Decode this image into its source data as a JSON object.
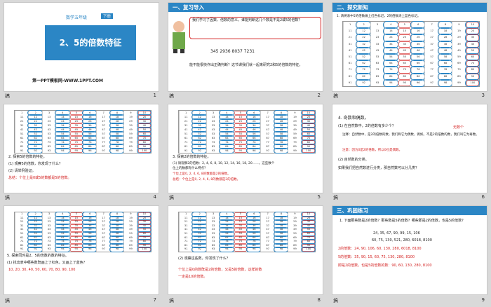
{
  "s1": {
    "tag": "数学五年级",
    "tag2": "下册",
    "title": "2、5的倍数特征",
    "footer": "第一PPT模板网-WWW.1PPT.COM",
    "num": "1",
    "icon": "搞"
  },
  "s2": {
    "header": "一、复习导入",
    "text": "我们学习了因数、倍数的意义，谁能判断这几个数是不是2或5的倍数？",
    "nums": "345    2936   8037   7231",
    "q": "能不能很快作出正确判断？这节课我们就一起来研究2和5的倍数的特征。",
    "num": "2",
    "icon": "搞"
  },
  "s3": {
    "header": "二、探究新知",
    "step": "1. 请将表中5的倍数做上红色标记，2的倍数涂上蓝色标记。",
    "num": "3",
    "icon": "搞"
  },
  "s4": {
    "step": "2. 探索5的倍数的特征。",
    "q1": "(1) 观察5的倍数，你发现了什么？",
    "q2": "(2) 请举例验证。",
    "ans": "总结：个位上是0或5的数都是5的倍数。",
    "num": "4",
    "icon": "搞"
  },
  "s5": {
    "step": "3. 探索2的倍数的特征。",
    "q1": "(1) 请观察2的倍数：2, 4, 6, 8, 10, 12, 14, 16, 18, 20……，这些数个",
    "q1b": "位上的数都有什么特点？",
    "ans": "个位上是0, 2, 4, 6, 8的数都是2的倍数。",
    "ans2": "总结：个位上是0, 2, 4, 6, 8的数都是2的倍数。",
    "num": "5",
    "icon": "搞"
  },
  "s6": {
    "step": "4. 奇数和偶数。",
    "q1": "(1) 在自然数中，2的倍数有多少个？",
    "side": "无数个",
    "def": "注释：自然数中，是2的倍数的数，我们称它为偶数，例如。不是2的倍数的数，我们叫它为奇数。",
    "note": "注意：因为0是2的倍数，所以0也是偶数。",
    "q2": "(2) 自然数的分类。",
    "q3": "如果我们把自然数进行分类，那自然数可以分几类？",
    "num": "6",
    "icon": "搞"
  },
  "s7": {
    "step": "5. 探索同时是2、5的倍数的数的特征。",
    "q1": "(1) 找出表中哪些数既画上了红色，又画上了蓝色？",
    "ans": "10, 20, 30, 40, 50, 60, 70, 80, 90, 100",
    "num": "7",
    "icon": "搞"
  },
  "s8": {
    "q": "(2) 观察这些数，你发现了什么？",
    "ans1": "个位上是0的数既是2的倍数，又是5的倍数，这样的数",
    "ans2": "一定是10的倍数。",
    "num": "8",
    "icon": "搞"
  },
  "s9": {
    "header": "三、巩固练习",
    "q": "1. 下面那些数是2的倍数？那些数是5的倍数？哪些即是2的倍数，也是5的倍数？",
    "nums1": "24, 35, 67, 90, 99, 15, 106",
    "nums2": "60, 75, 130, 521, 280, 6018, 8100",
    "a1": "2的倍数：24, 90, 106, 60, 130, 280, 6018, 8100",
    "a2": "5的倍数：35, 90, 15, 60, 75, 130, 280, 8100",
    "a3": "即是2的倍数，也是5的倍数的数：90, 60, 130, 280, 8100",
    "num": "9",
    "icon": "搞"
  },
  "colors": {
    "blue": "#2b86c5",
    "red": "#d32020"
  }
}
